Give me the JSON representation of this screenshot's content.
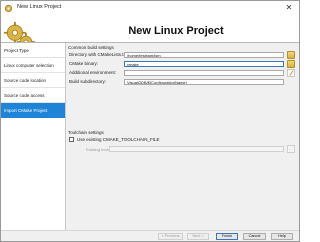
{
  "window": {
    "title": "New Linux Project"
  },
  "header": {
    "title": "New Linux Project"
  },
  "sidebar": {
    "items": [
      {
        "label": "Project Type"
      },
      {
        "label": "Linux computer selection"
      },
      {
        "label": "Source code location"
      },
      {
        "label": "Source code access"
      },
      {
        "label": "Import CMake Project",
        "active": true
      }
    ]
  },
  "main": {
    "common_section": "Common build settings",
    "fields": [
      {
        "label": "Directory with CMakeLists.txt:",
        "value": "/home/tesleam/jsm"
      },
      {
        "label": "CMake binary:",
        "value": "cmake"
      },
      {
        "label": "Additional environment:",
        "value": ""
      },
      {
        "label": "Build subdirectory:",
        "value": "VisualGDB/$(ConfigurationName)"
      }
    ],
    "toolchain_section": "Toolchain settings",
    "use_existing_label": "Use existing CMAKE_TOOLCHAIN_FILE",
    "use_existing_checked": false,
    "existing_toolchain_label": "Existing toolchain file:",
    "existing_toolchain_value": ""
  },
  "footer": {
    "previous": "< Previous",
    "next": "Next >",
    "finish": "Finish",
    "cancel": "Cancel",
    "help": "Help"
  },
  "icons": {
    "logo": "gears-icon",
    "browse": "folder-icon",
    "edit": "pencil-icon"
  },
  "colors": {
    "accent": "#1e84d8",
    "focus": "#3a76c4"
  }
}
